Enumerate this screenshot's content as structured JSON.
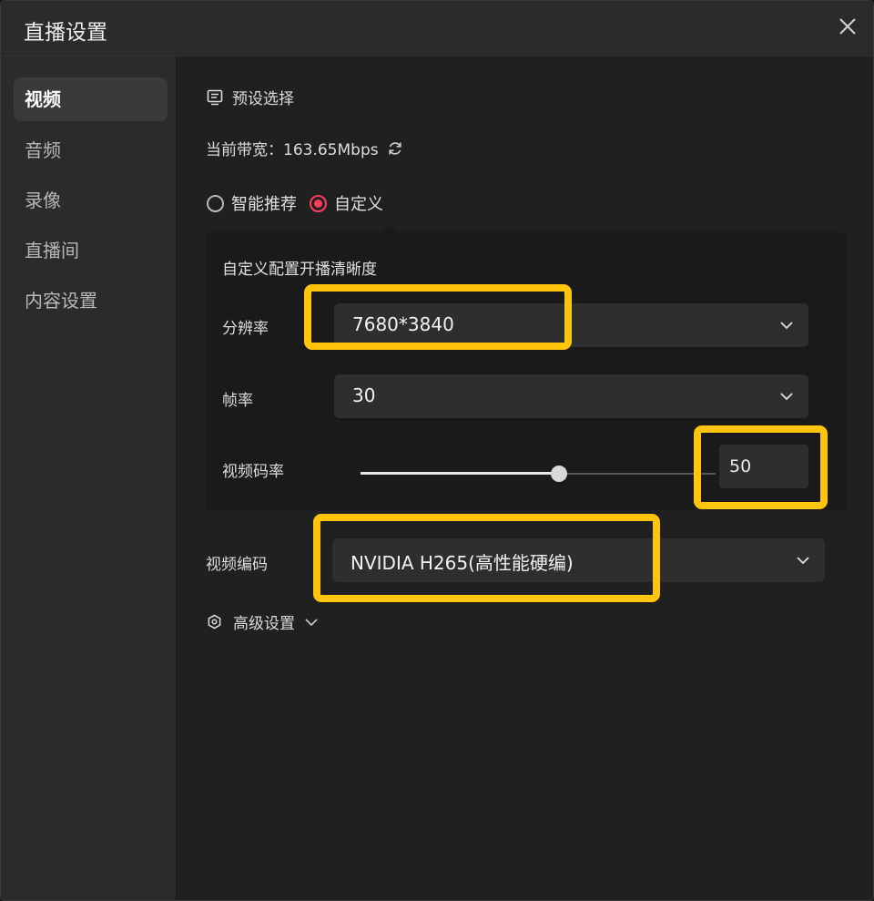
{
  "window": {
    "title": "直播设置"
  },
  "sidebar": {
    "items": [
      {
        "label": "视频",
        "active": true
      },
      {
        "label": "音频",
        "active": false
      },
      {
        "label": "录像",
        "active": false
      },
      {
        "label": "直播间",
        "active": false
      },
      {
        "label": "内容设置",
        "active": false
      }
    ]
  },
  "main": {
    "preset": {
      "label": "预设选择",
      "icon": "monitor-list-icon"
    },
    "bandwidth": {
      "text": "当前带宽：163.65Mbps",
      "icon": "refresh-icon"
    },
    "mode": {
      "options": [
        "智能推荐",
        "自定义"
      ],
      "selected": "自定义"
    },
    "custom": {
      "title": "自定义配置开播清晰度",
      "resolution": {
        "label": "分辨率",
        "value": "7680*3840"
      },
      "framerate": {
        "label": "帧率",
        "value": "30"
      },
      "bitrate": {
        "label": "视频码率",
        "value": "50",
        "slider_fraction": 0.56
      }
    },
    "codec": {
      "label": "视频编码",
      "value": "NVIDIA H265(高性能硬编)"
    },
    "advanced": {
      "label": "高级设置",
      "icon": "hexagon-settings-icon"
    }
  },
  "colors": {
    "accent": "#ff3e5e",
    "highlight": "#ffc40c",
    "background": "#202020",
    "sidebar": "#2b2b2b"
  }
}
